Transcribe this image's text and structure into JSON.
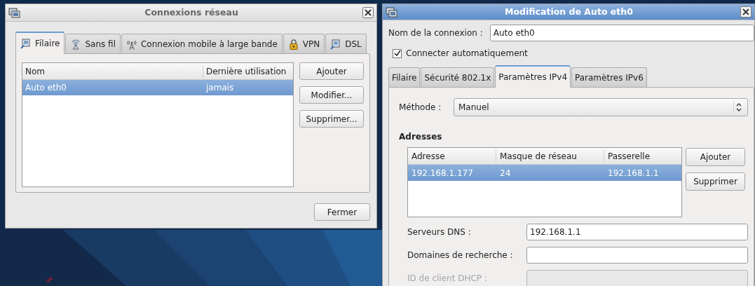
{
  "network_connections": {
    "title": "Connexions réseau",
    "active": false,
    "tabs": [
      {
        "label": "Filaire",
        "kind": "wired",
        "selected": true
      },
      {
        "label": "Sans fil",
        "kind": "wireless",
        "selected": false
      },
      {
        "label": "Connexion mobile à large bande",
        "kind": "mobile",
        "selected": false
      },
      {
        "label": "VPN",
        "kind": "vpn",
        "selected": false
      },
      {
        "label": "DSL",
        "kind": "wired",
        "selected": false
      }
    ],
    "table": {
      "columns": [
        "Nom",
        "Dernière utilisation"
      ],
      "rows": [
        {
          "cells": [
            "Auto eth0",
            "jamais"
          ],
          "selected": true
        }
      ]
    },
    "buttons": [
      "Ajouter",
      "Modifier...",
      "Supprimer..."
    ],
    "close_button": "Fermer"
  },
  "edit_connection": {
    "title": "Modification de Auto eth0",
    "active": true,
    "name_label": "Nom de la connexion :",
    "name_value": "Auto eth0",
    "autoconnect": {
      "label": "Connecter automatiquement",
      "checked": true
    },
    "tabs": [
      {
        "label": "Filaire",
        "selected": false
      },
      {
        "label": "Sécurité 802.1x",
        "selected": false
      },
      {
        "label": "Paramètres IPv4",
        "selected": true
      },
      {
        "label": "Paramètres IPv6",
        "selected": false
      }
    ],
    "method": {
      "label": "Méthode :",
      "value": "Manuel"
    },
    "addresses": {
      "heading": "Adresses",
      "columns": [
        "Adresse",
        "Masque de réseau",
        "Passerelle"
      ],
      "rows": [
        {
          "cells": [
            "192.168.1.177",
            "24",
            "192.168.1.1"
          ],
          "selected": true
        }
      ],
      "buttons": [
        "Ajouter",
        "Supprimer"
      ]
    },
    "fields": [
      {
        "label": "Serveurs DNS :",
        "value": "192.168.1.1",
        "disabled": false
      },
      {
        "label": "Domaines de recherche :",
        "disabled": false
      },
      {
        "label": "ID de client DHCP :",
        "disabled": true
      }
    ]
  }
}
